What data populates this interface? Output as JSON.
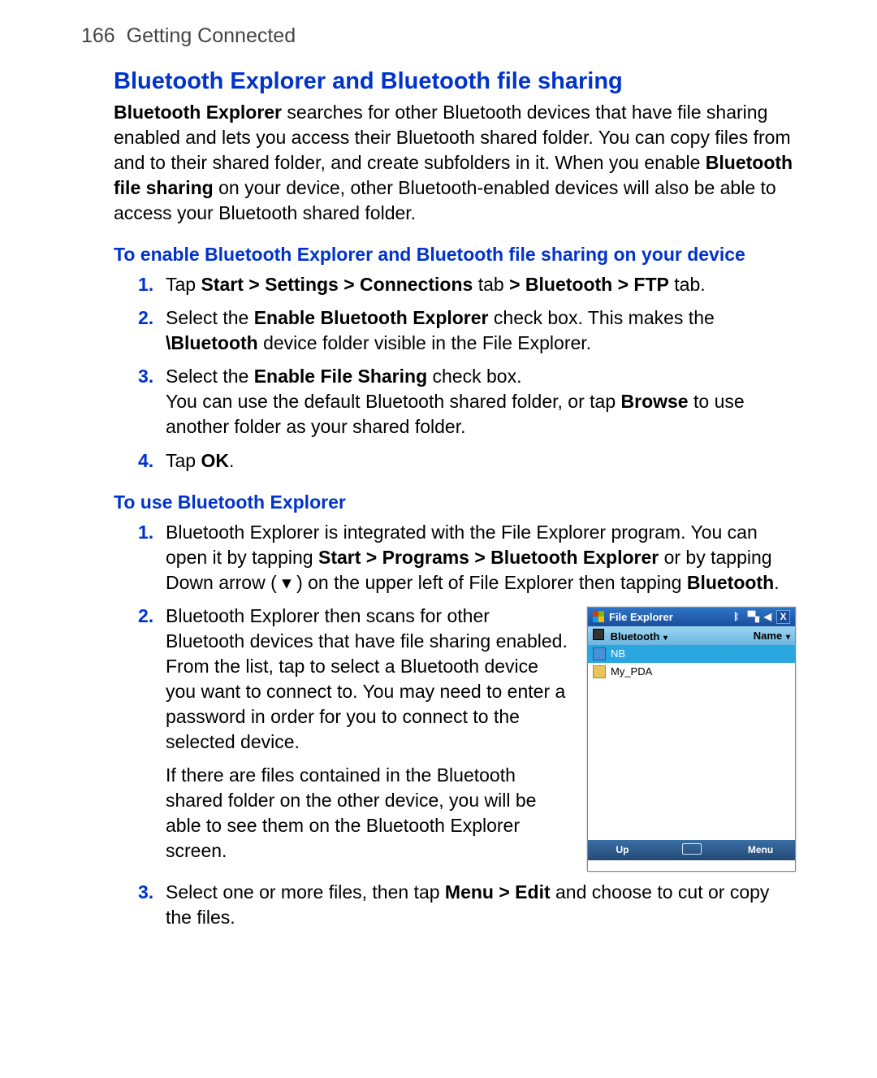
{
  "header": {
    "page_number": "166",
    "chapter": "Getting Connected"
  },
  "section": {
    "title": "Bluetooth Explorer and Bluetooth file sharing",
    "intro": {
      "t1a": "Bluetooth Explorer",
      "t1b": " searches for other Bluetooth devices that have file sharing enabled and lets you access their Bluetooth shared folder. You can copy files from and to their shared folder, and create subfolders in it. When you enable ",
      "t1c": "Bluetooth file sharing",
      "t1d": " on your device, other Bluetooth-enabled devices will also be able to access your Bluetooth shared folder."
    },
    "sub1": {
      "title": "To enable Bluetooth Explorer and Bluetooth file sharing on your device",
      "steps": [
        {
          "pre": "Tap ",
          "b1": "Start > Settings > Connections",
          "mid": " tab ",
          "b2": "> Bluetooth > FTP",
          "post": " tab."
        },
        {
          "pre": "Select the ",
          "b1": "Enable Bluetooth Explorer",
          "mid": " check box. This makes the ",
          "b2": "\\Bluetooth",
          "post": " device folder visible in the File Explorer."
        },
        {
          "pre": "Select the ",
          "b1": "Enable File Sharing",
          "mid": " check box.",
          "extra_pre": "You can use the default Bluetooth shared folder, or tap ",
          "extra_b": "Browse",
          "extra_post": " to use another folder as your shared folder."
        },
        {
          "pre": "Tap ",
          "b1": "OK",
          "post": "."
        }
      ]
    },
    "sub2": {
      "title": "To use Bluetooth Explorer",
      "step1": {
        "pre": "Bluetooth Explorer is integrated with the File Explorer program. You can open it by tapping ",
        "b1": "Start > Programs > Bluetooth Explorer",
        "mid": " or by tapping Down arrow ( ",
        "arrow": "▾",
        "mid2": " ) on the upper left of File Explorer then tapping ",
        "b2": "Bluetooth",
        "post": "."
      },
      "step2": {
        "text": "Bluetooth Explorer then scans for other Bluetooth devices that have file sharing enabled. From the list, tap to select a Bluetooth device you want to connect to. You may need to enter a password in order for you to connect to the selected device.",
        "text2": "If there are files contained in the Bluetooth shared folder on the other device, you will be able to see them on the Bluetooth Explorer screen."
      },
      "step3": {
        "pre": "Select one or more files, then tap ",
        "b1": "Menu > Edit",
        "post": " and choose to cut or copy the files."
      }
    }
  },
  "screenshot": {
    "title": "File Explorer",
    "breadcrumb": "Bluetooth",
    "sort": "Name",
    "items": [
      {
        "name": "NB",
        "selected": true,
        "icon": "pc-icon"
      },
      {
        "name": "My_PDA",
        "selected": false,
        "icon": "folder-icon"
      }
    ],
    "footer_left": "Up",
    "footer_right": "Menu",
    "close": "X"
  }
}
